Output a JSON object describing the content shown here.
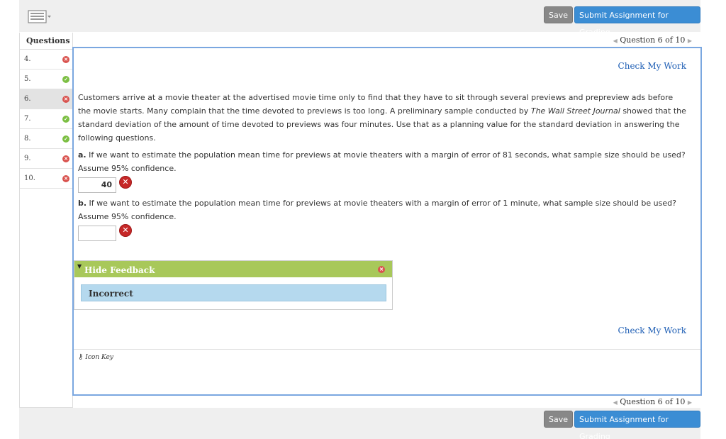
{
  "toolbar": {
    "keyboard_icon": "keyboard-icon",
    "save_label": "Save",
    "submit_label": "Submit Assignment for Grading"
  },
  "sidebar": {
    "title": "Questions",
    "items": [
      {
        "number": "4.",
        "status": "incorrect"
      },
      {
        "number": "5.",
        "status": "correct"
      },
      {
        "number": "6.",
        "status": "incorrect"
      },
      {
        "number": "7.",
        "status": "correct"
      },
      {
        "number": "8.",
        "status": "correct"
      },
      {
        "number": "9.",
        "status": "incorrect"
      },
      {
        "number": "10.",
        "status": "incorrect"
      }
    ]
  },
  "nav": {
    "label": "Question 6 of 10"
  },
  "question": {
    "check_my_work": "Check My Work",
    "intro_part1": "Customers arrive at a movie theater at the advertised movie time only to find that they have to sit through several previews and prepreview ads before the movie starts. Many complain that the time devoted to previews is too long. A preliminary sample conducted by ",
    "intro_source": "The Wall Street Journal",
    "intro_part2": " showed that the standard deviation of the amount of time devoted to previews was four minutes. Use that as a planning value for the standard deviation in answering the following questions.",
    "part_a_label": "a.",
    "part_a_text": " If we want to estimate the population mean time for previews at movie theaters with a margin of error of 81 seconds, what sample size should be used? Assume 95% confidence.",
    "part_a_answer": "40",
    "part_b_label": "b.",
    "part_b_text": " If we want to estimate the population mean time for previews at movie theaters with a margin of error of 1 minute, what sample size should be used? Assume 95% confidence.",
    "part_b_answer": ""
  },
  "feedback": {
    "header": "Hide Feedback",
    "result": "Incorrect"
  },
  "icon_key": "Icon Key",
  "colors": {
    "accent_blue": "#3b8dd4",
    "feedback_green": "#a8c85a",
    "incorrect_red": "#c62828",
    "correct_green": "#7cbf43"
  }
}
